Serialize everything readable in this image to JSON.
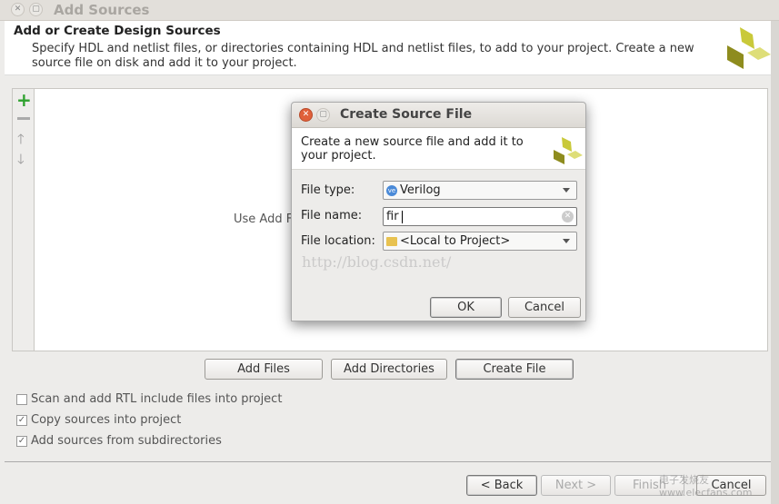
{
  "window": {
    "title": "Add Sources"
  },
  "header": {
    "title": "Add or Create Design Sources",
    "description": "Specify HDL and netlist files, or directories containing HDL and netlist files, to add to your project. Create a new source file on disk and add it to your project."
  },
  "panel": {
    "hint": "Use Add Files, Add Directories or Create File buttons below"
  },
  "actions": {
    "add_files": "Add Files",
    "add_directories": "Add Directories",
    "create_file": "Create File"
  },
  "options": [
    {
      "label": "Scan and add RTL include files into project",
      "checked": false
    },
    {
      "label": "Copy sources into project",
      "checked": true
    },
    {
      "label": "Add sources from subdirectories",
      "checked": true
    }
  ],
  "footer": {
    "back": "< Back",
    "next": "Next >",
    "finish": "Finish",
    "cancel": "Cancel"
  },
  "dialog": {
    "title": "Create Source File",
    "description": "Create a new source file and add it to your project.",
    "file_type_label": "File type:",
    "file_type_value": "Verilog",
    "file_name_label": "File name:",
    "file_name_value": "fir",
    "file_location_label": "File location:",
    "file_location_value": "<Local to Project>",
    "ok": "OK",
    "cancel": "Cancel"
  },
  "watermarks": {
    "csdn": "http://blog.csdn.net/",
    "elecfans": "电子发烧友 www.elecfans.com"
  },
  "colors": {
    "logo_dark": "#8e8c1e",
    "logo_light": "#d6d65a",
    "add_green": "#2ea12e",
    "close_red": "#e0603a"
  }
}
